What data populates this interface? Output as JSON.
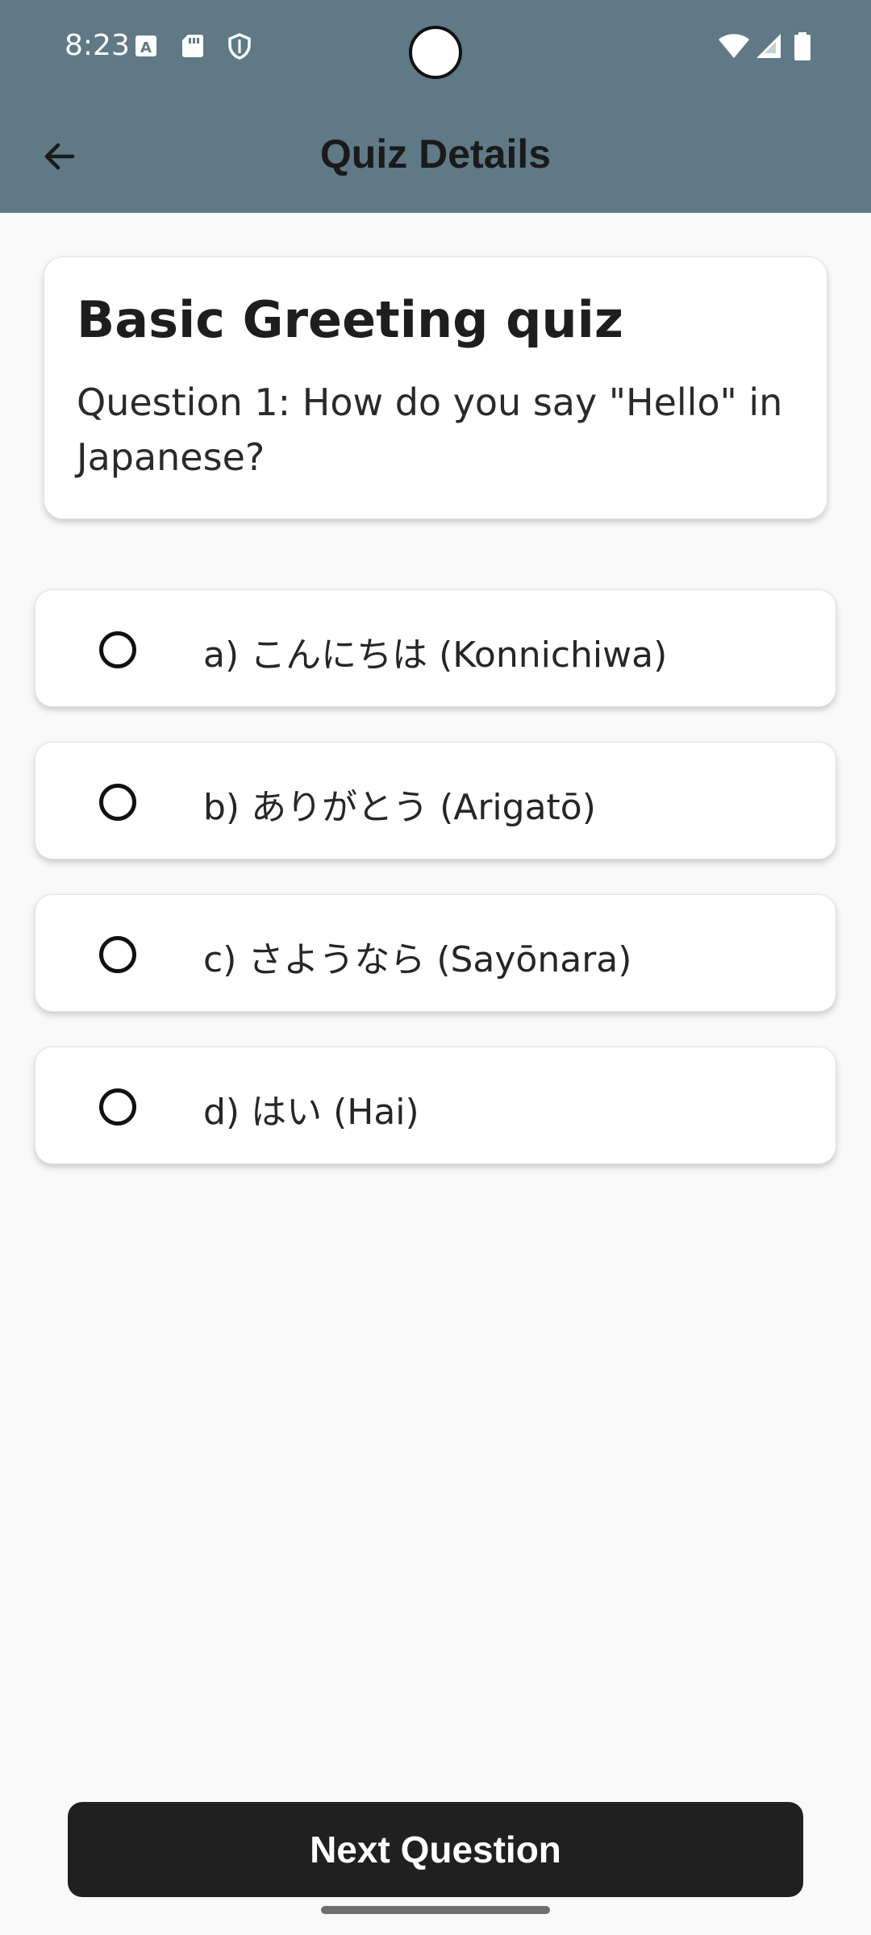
{
  "status_bar": {
    "time": "8:23",
    "icons": [
      "font-a-icon",
      "sd-card-icon",
      "shield-icon",
      "wifi-icon",
      "cell-signal-icon",
      "battery-icon"
    ]
  },
  "app_bar": {
    "title": "Quiz Details",
    "back_icon": "arrow-back-icon"
  },
  "quiz": {
    "title": "Basic Greeting quiz",
    "question": "Question 1: How do you say \"Hello\" in Japanese?"
  },
  "options": [
    {
      "label": "a) こんにちは (Konnichiwa)",
      "selected": false
    },
    {
      "label": "b) ありがとう (Arigatō)",
      "selected": false
    },
    {
      "label": "c) さようなら (Sayōnara)",
      "selected": false
    },
    {
      "label": "d) はい (Hai)",
      "selected": false
    }
  ],
  "actions": {
    "next_label": "Next Question"
  },
  "colors": {
    "app_bar": "#5f7986",
    "background": "#f9f9f9",
    "button": "#202020"
  }
}
